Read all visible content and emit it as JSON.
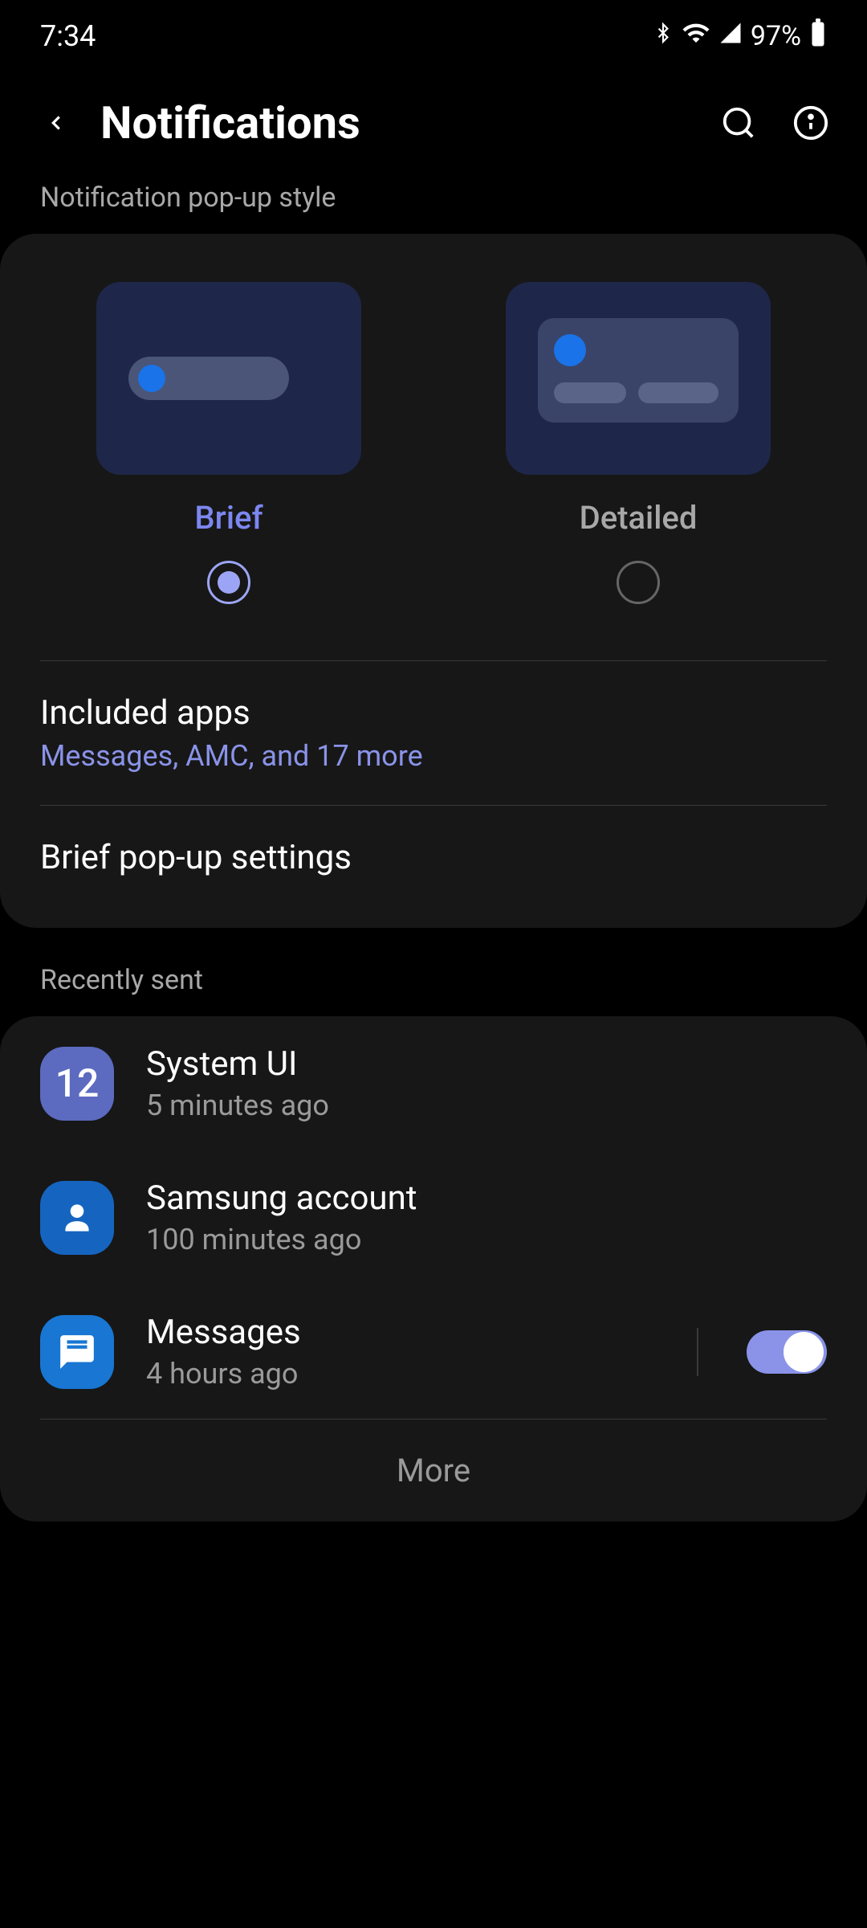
{
  "status": {
    "time": "7:34",
    "battery": "97%"
  },
  "header": {
    "title": "Notifications"
  },
  "sections": {
    "popup_style": "Notification pop-up style",
    "recently_sent": "Recently sent"
  },
  "style_options": {
    "brief": "Brief",
    "detailed": "Detailed"
  },
  "included_apps": {
    "title": "Included apps",
    "subtitle": "Messages, AMC, and 17 more"
  },
  "brief_settings": {
    "title": "Brief pop-up settings"
  },
  "recent_apps": [
    {
      "name": "System UI",
      "time": "5 minutes ago",
      "icon_text": "12"
    },
    {
      "name": "Samsung account",
      "time": "100 minutes ago"
    },
    {
      "name": "Messages",
      "time": "4 hours ago"
    }
  ],
  "more": "More"
}
